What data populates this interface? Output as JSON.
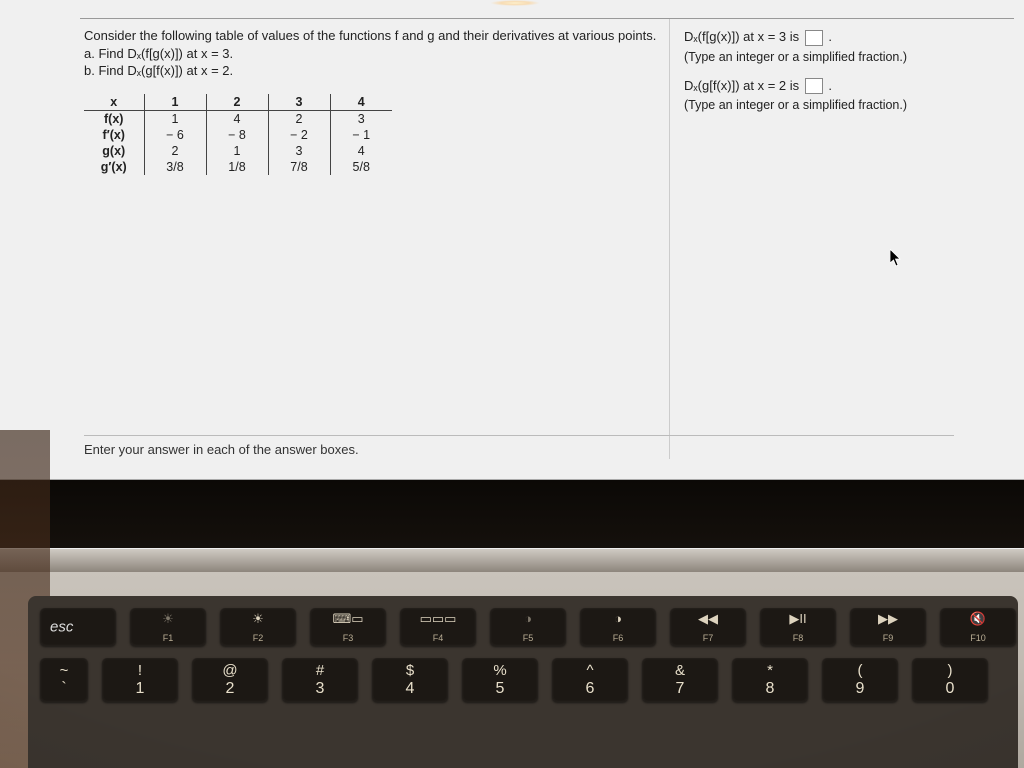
{
  "problem": {
    "intro": "Consider the following table of values of the functions f and g and their derivatives at various points.",
    "part_a": "a. Find Dₓ(f[g(x)]) at x = 3.",
    "part_b": "b. Find Dₓ(g[f(x)]) at x = 2."
  },
  "table": {
    "headers": [
      "x",
      "1",
      "2",
      "3",
      "4"
    ],
    "rows": [
      {
        "label": "f(x)",
        "vals": [
          "1",
          "4",
          "2",
          "3"
        ]
      },
      {
        "label": "f′(x)",
        "vals": [
          "− 6",
          "− 8",
          "− 2",
          "− 1"
        ]
      },
      {
        "label": "g(x)",
        "vals": [
          "2",
          "1",
          "3",
          "4"
        ]
      },
      {
        "label": "g′(x)",
        "vals": [
          "3/8",
          "1/8",
          "7/8",
          "5/8"
        ]
      }
    ]
  },
  "answers": {
    "line1_pre": "Dₓ(f[g(x)]) at x = 3 is ",
    "line1_post": ".",
    "hint1": "(Type an integer or a simplified fraction.)",
    "line2_pre": "Dₓ(g[f(x)]) at x = 2 is ",
    "line2_post": ".",
    "hint2": "(Type an integer or a simplified fraction.)"
  },
  "footer": "Enter your answer in each of the answer boxes.",
  "keyboard": {
    "esc": "esc",
    "fn": [
      {
        "icon": "☀",
        "dim": true,
        "label": "F1"
      },
      {
        "icon": "☀",
        "label": "F2"
      },
      {
        "icon": "⌨▭",
        "label": "F3"
      },
      {
        "icon": "▭▭▭",
        "label": "F4"
      },
      {
        "icon": "◑",
        "dim": true,
        "label": "F5"
      },
      {
        "icon": "◑",
        "label": "F6"
      },
      {
        "icon": "◀◀",
        "label": "F7"
      },
      {
        "icon": "▶II",
        "label": "F8"
      },
      {
        "icon": "▶▶",
        "label": "F9"
      },
      {
        "icon": "🔇",
        "label": "F10"
      }
    ],
    "num": [
      {
        "top": "~",
        "bot": "`"
      },
      {
        "top": "!",
        "bot": "1"
      },
      {
        "top": "@",
        "bot": "2"
      },
      {
        "top": "#",
        "bot": "3"
      },
      {
        "top": "$",
        "bot": "4"
      },
      {
        "top": "%",
        "bot": "5"
      },
      {
        "top": "^",
        "bot": "6"
      },
      {
        "top": "&",
        "bot": "7"
      },
      {
        "top": "*",
        "bot": "8"
      },
      {
        "top": "(",
        "bot": "9"
      },
      {
        "top": ")",
        "bot": "0"
      }
    ]
  }
}
